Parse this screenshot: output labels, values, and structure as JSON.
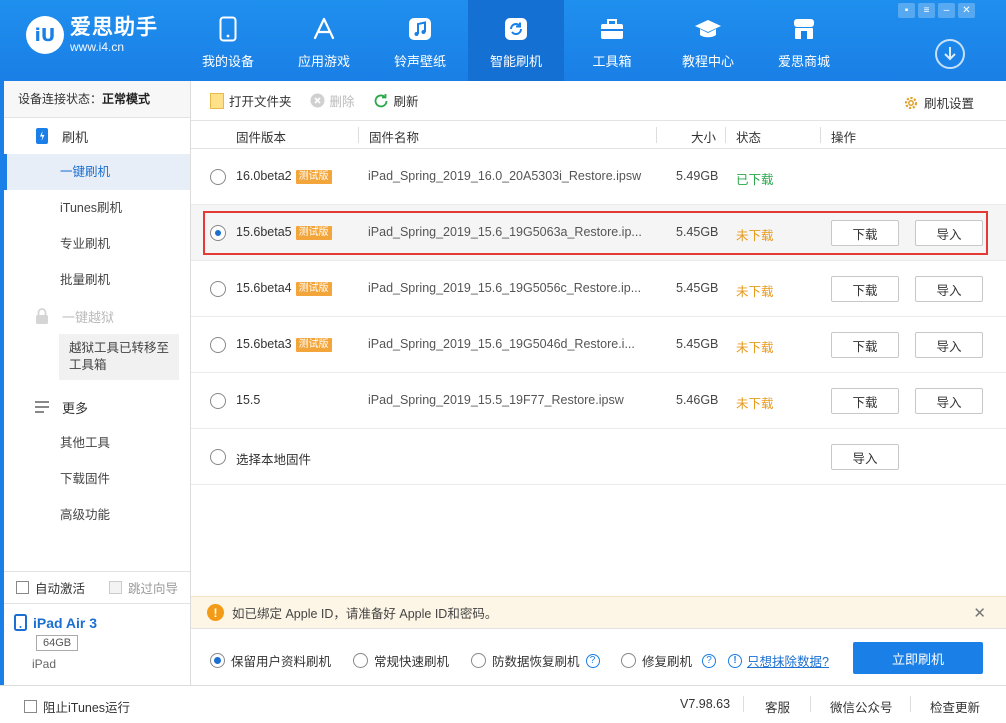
{
  "app": {
    "logo_mark": "iU",
    "logo_title": "爱思助手",
    "logo_url": "www.i4.cn"
  },
  "nav": [
    {
      "label": "我的设备",
      "icon": "phone-icon"
    },
    {
      "label": "应用游戏",
      "icon": "app-store-icon"
    },
    {
      "label": "铃声壁纸",
      "icon": "music-icon"
    },
    {
      "label": "智能刷机",
      "icon": "refresh-box-icon"
    },
    {
      "label": "工具箱",
      "icon": "toolbox-icon"
    },
    {
      "label": "教程中心",
      "icon": "graduation-cap-icon"
    },
    {
      "label": "爱思商城",
      "icon": "shop-icon"
    }
  ],
  "sidebar": {
    "conn_label": "设备连接状态：",
    "conn_value": "正常模式",
    "flash_group": "刷机",
    "flash_items": [
      "一键刷机",
      "iTunes刷机",
      "专业刷机",
      "批量刷机"
    ],
    "jailbreak_group": "一键越狱",
    "jailbreak_note": "越狱工具已转移至工具箱",
    "more_group": "更多",
    "more_items": [
      "其他工具",
      "下载固件",
      "高级功能"
    ],
    "auto_activate": "自动激活",
    "skip_guide": "跳过向导",
    "device_name": "iPad Air 3",
    "device_capacity": "64GB",
    "device_type": "iPad"
  },
  "toolbar": {
    "open_folder": "打开文件夹",
    "delete": "删除",
    "refresh": "刷新",
    "settings": "刷机设置"
  },
  "table": {
    "headers": {
      "version": "固件版本",
      "name": "固件名称",
      "size": "大小",
      "status": "状态",
      "action": "操作"
    },
    "rows": [
      {
        "version": "16.0beta2",
        "tag": "测试版",
        "name": "iPad_Spring_2019_16.0_20A5303i_Restore.ipsw",
        "size": "5.49GB",
        "status": "已下载",
        "status_type": "ok"
      },
      {
        "version": "15.6beta5",
        "tag": "测试版",
        "name": "iPad_Spring_2019_15.6_19G5063a_Restore.ip...",
        "size": "5.45GB",
        "status": "未下载",
        "status_type": "no"
      },
      {
        "version": "15.6beta4",
        "tag": "测试版",
        "name": "iPad_Spring_2019_15.6_19G5056c_Restore.ip...",
        "size": "5.45GB",
        "status": "未下载",
        "status_type": "no"
      },
      {
        "version": "15.6beta3",
        "tag": "测试版",
        "name": "iPad_Spring_2019_15.6_19G5046d_Restore.i...",
        "size": "5.45GB",
        "status": "未下载",
        "status_type": "no"
      },
      {
        "version": "15.5",
        "tag": "",
        "name": "iPad_Spring_2019_15.5_19F77_Restore.ipsw",
        "size": "5.46GB",
        "status": "未下载",
        "status_type": "no"
      }
    ],
    "local_row": "选择本地固件",
    "download_label": "下载",
    "import_label": "导入"
  },
  "notice": {
    "icon": "!",
    "text": "如已绑定 Apple ID，请准备好 Apple ID和密码。"
  },
  "options": {
    "keep_data": "保留用户资料刷机",
    "quick": "常规快速刷机",
    "anti_recovery": "防数据恢复刷机",
    "repair": "修复刷机",
    "erase_link": "只想抹除数据?",
    "flash_now": "立即刷机"
  },
  "statusbar": {
    "block_itunes": "阻止iTunes运行",
    "version": "V7.98.63",
    "service": "客服",
    "wechat": "微信公众号",
    "check_update": "检查更新"
  },
  "colors": {
    "brand_blue": "#1a7fe6",
    "ok_green": "#2aa84a",
    "warn_orange": "#e89a1b",
    "highlight_red": "#e53935"
  }
}
